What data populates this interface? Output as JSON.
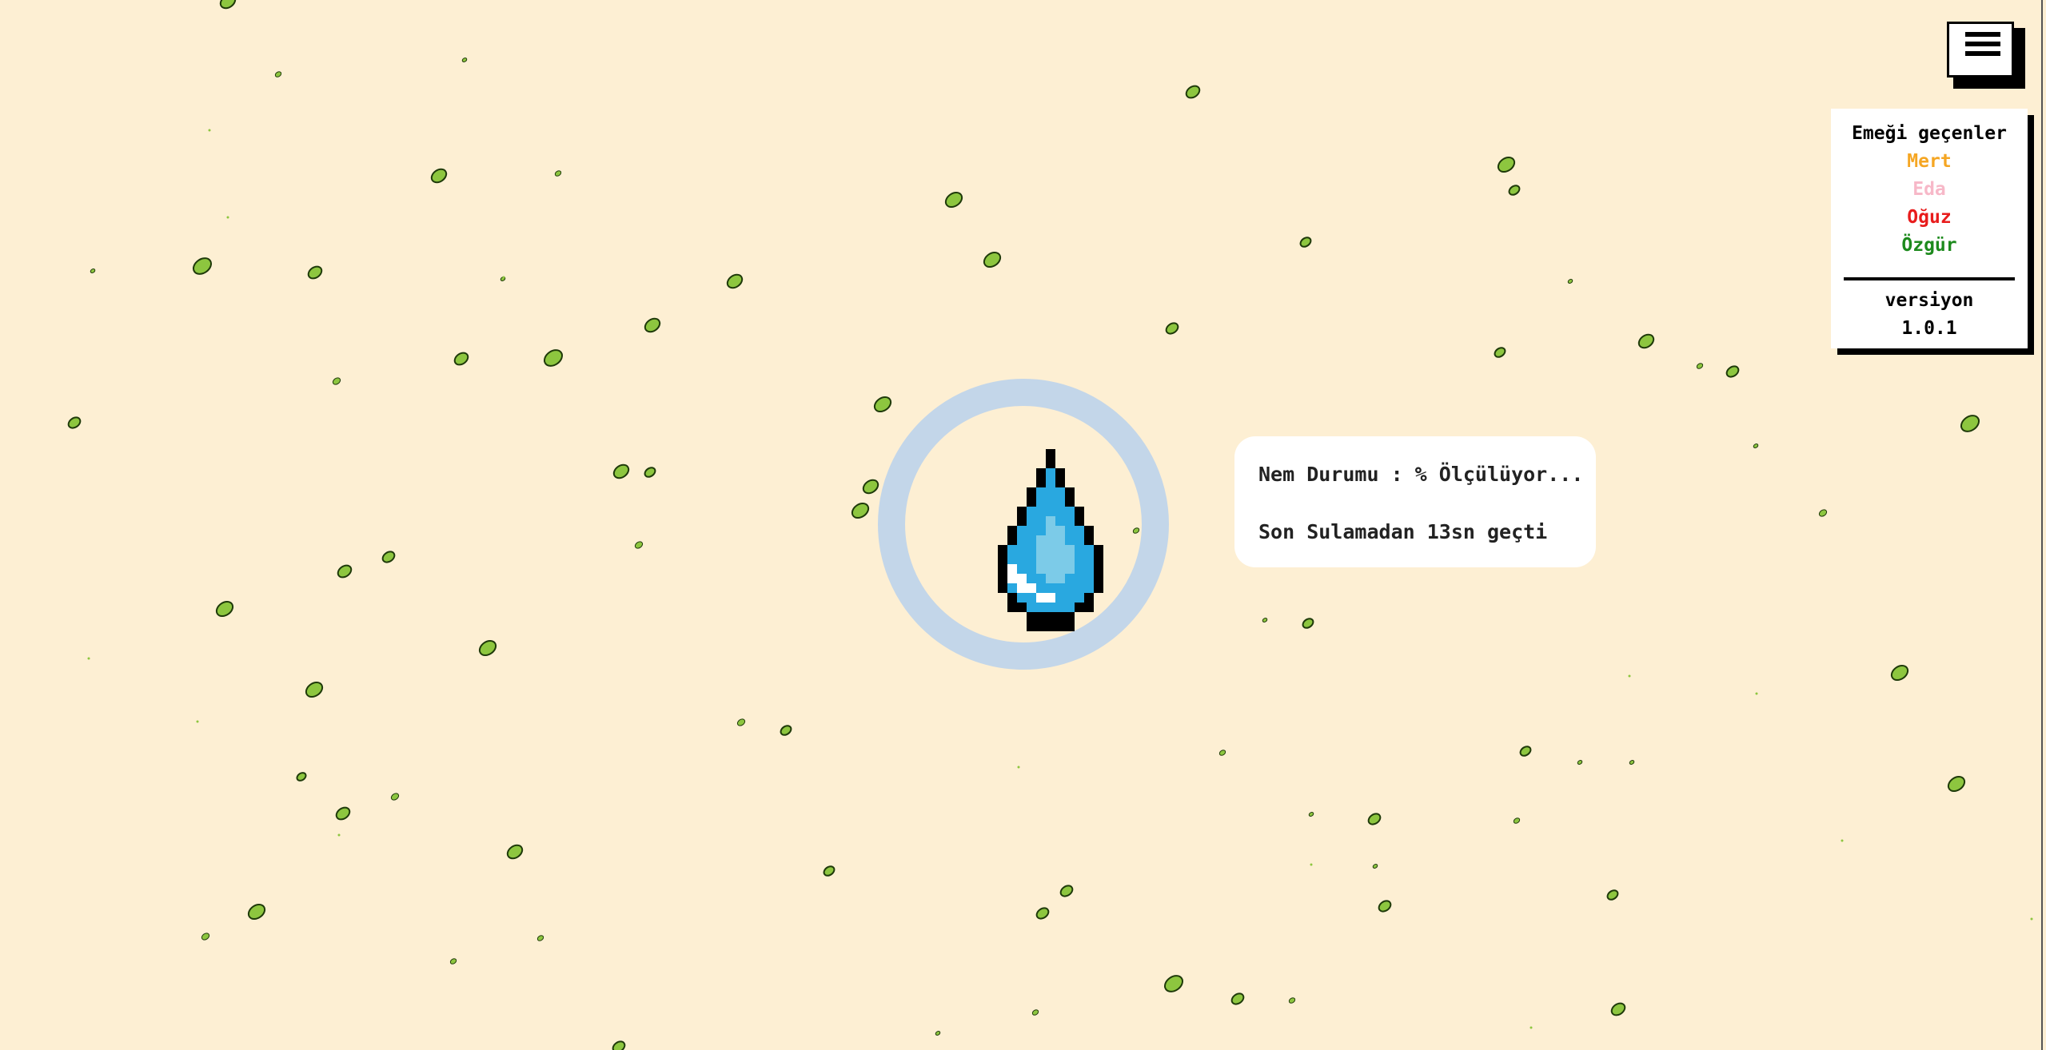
{
  "menu": {
    "icon": "hamburger-menu-icon"
  },
  "credits": {
    "heading": "Emeği geçenler",
    "names": [
      "Mert",
      "Eda",
      "Oğuz",
      "Özgür"
    ],
    "version_label": "versiyon",
    "version": "1.0.1"
  },
  "watering": {
    "icon": "water-drop-icon"
  },
  "status": {
    "moisture": "Nem Durumu : % Ölçülüyor...",
    "last_watering": "Son Sulamadan 13sn geçti"
  },
  "colors": {
    "background": "#fdefd3",
    "leaf": "#8dc63f",
    "ring": "#c3d6e9",
    "drop": "#29a8e0"
  }
}
